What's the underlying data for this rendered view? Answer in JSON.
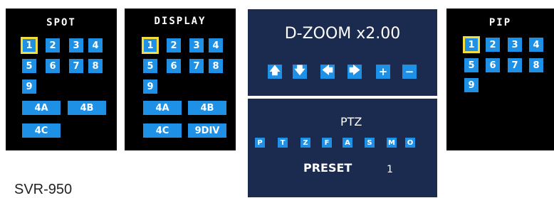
{
  "spot": {
    "title": "SPOT",
    "channels": [
      "1",
      "2",
      "3",
      "4",
      "5",
      "6",
      "7",
      "8",
      "9"
    ],
    "extra": [
      "4A",
      "4B",
      "4C"
    ]
  },
  "display": {
    "title": "DISPLAY",
    "channels": [
      "1",
      "2",
      "3",
      "4",
      "5",
      "6",
      "7",
      "8",
      "9"
    ],
    "extra": [
      "4A",
      "4B",
      "4C",
      "9DIV"
    ]
  },
  "zoom": {
    "title": "D-ZOOM x2.00",
    "buttons": [
      "up",
      "down",
      "left",
      "right",
      "plus",
      "minus"
    ],
    "glyphs": [
      "🡅",
      "🡇",
      "🡄",
      "🡆",
      "+",
      "−"
    ]
  },
  "ptz": {
    "title": "PTZ",
    "buttons": [
      "P",
      "T",
      "Z",
      "F",
      "A",
      "S",
      "M",
      "O"
    ],
    "preset_label": "PRESET",
    "preset_value": "1"
  },
  "pip": {
    "title": "PIP",
    "channels": [
      "1",
      "2",
      "3",
      "4",
      "5",
      "6",
      "7",
      "8",
      "9"
    ]
  },
  "footer": {
    "model": "SVR-950"
  },
  "colors": {
    "button_blue": "#1e90e6",
    "selection_yellow": "#f2dd3a",
    "navy_panel": "#1b2a4f"
  }
}
